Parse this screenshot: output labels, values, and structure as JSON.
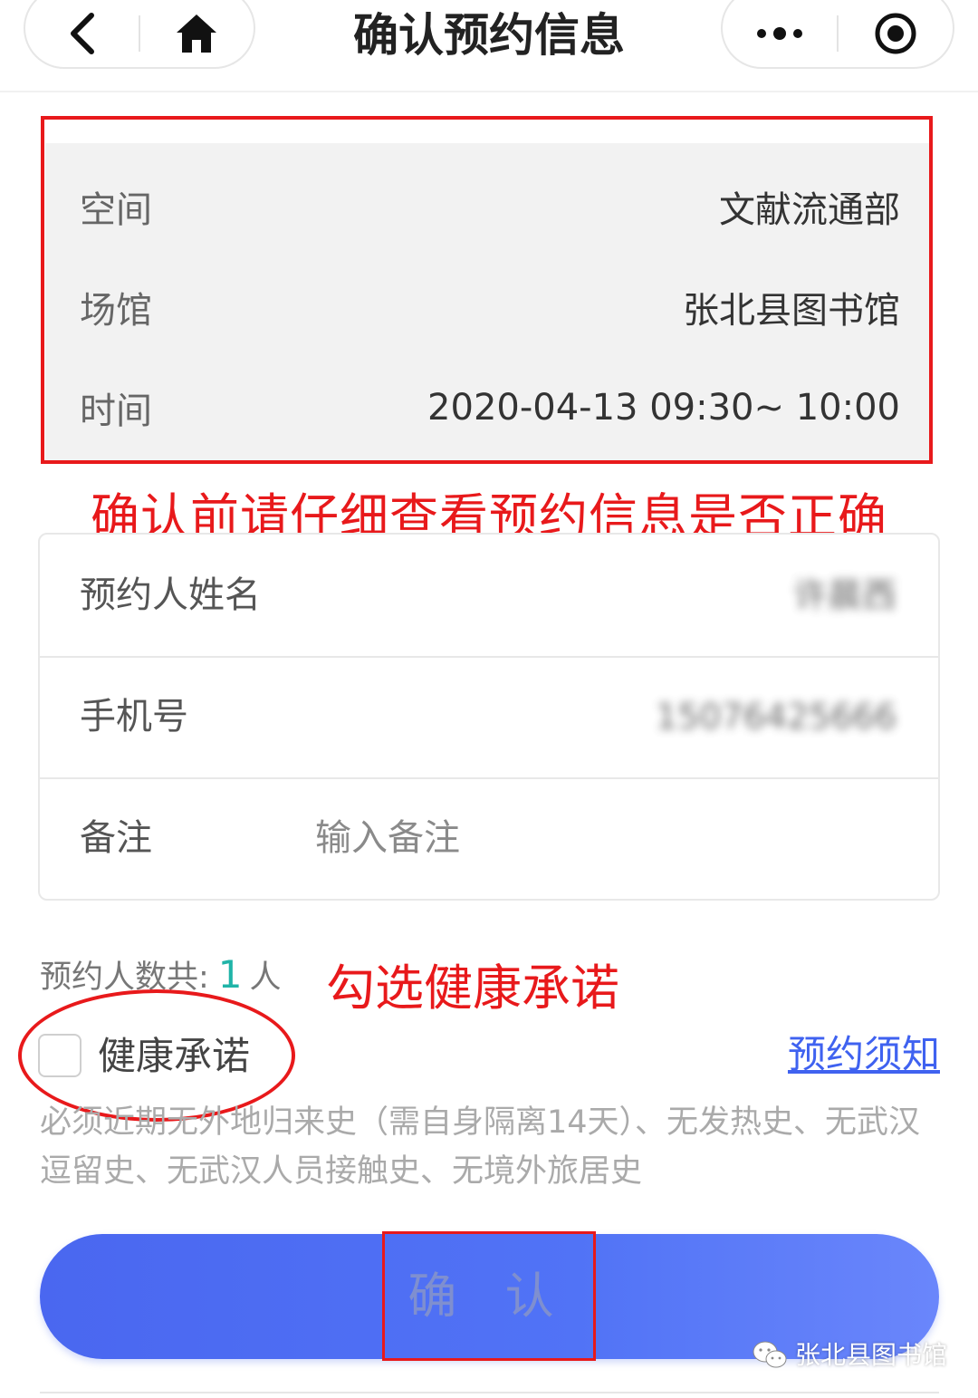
{
  "nav": {
    "title": "确认预约信息",
    "icons": [
      "back-arrow-icon",
      "home-icon",
      "more-dots-icon",
      "record-target-icon"
    ]
  },
  "booking_info": {
    "rows": [
      {
        "label": "空间",
        "value": "文献流通部"
      },
      {
        "label": "场馆",
        "value": "张北县图书馆"
      },
      {
        "label": "时间",
        "value": "2020-04-13 09:30~ 10:00"
      }
    ]
  },
  "annotations": {
    "check_info": "确认前请仔细查看预约信息是否正确",
    "tick_health": "勾选健康承诺"
  },
  "form": {
    "name_label": "预约人姓名",
    "name_value": "许晨西",
    "phone_label": "手机号",
    "phone_value": "15076425666",
    "remark_label": "备注",
    "remark_placeholder": "输入备注"
  },
  "count": {
    "prefix": "预约人数共:",
    "number": "1",
    "unit": "人"
  },
  "health": {
    "label": "健康承诺",
    "notice_link": "预约须知",
    "description": "必须近期无外地归来史（需自身隔离14天）、无发热史、无武汉逗留史、无武汉人员接触史、无境外旅居史"
  },
  "confirm_button": "确 认",
  "watermark": "张北县图书馆",
  "colors": {
    "highlight_red": "#e8191b",
    "accent_blue": "#4a67f0",
    "count_teal": "#20b4a8",
    "link_blue": "#3f62f0"
  }
}
